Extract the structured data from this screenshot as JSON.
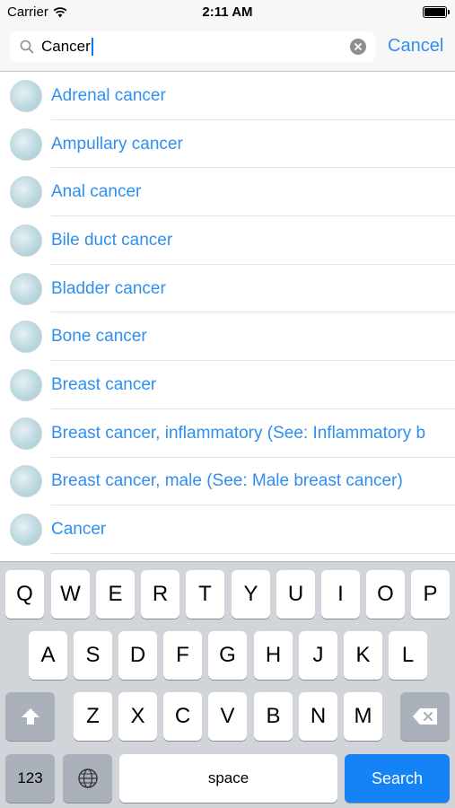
{
  "status_bar": {
    "carrier": "Carrier",
    "time": "2:11 AM"
  },
  "search": {
    "query": "Cancer",
    "cancel_label": "Cancel"
  },
  "results": [
    {
      "label": "Adrenal cancer"
    },
    {
      "label": "Ampullary cancer"
    },
    {
      "label": "Anal cancer"
    },
    {
      "label": "Bile duct cancer"
    },
    {
      "label": "Bladder cancer"
    },
    {
      "label": "Bone cancer"
    },
    {
      "label": "Breast cancer"
    },
    {
      "label": "Breast cancer, inflammatory (See: Inflammatory b"
    },
    {
      "label": "Breast cancer, male (See: Male breast cancer)"
    },
    {
      "label": "Cancer"
    }
  ],
  "keyboard": {
    "row1": [
      "Q",
      "W",
      "E",
      "R",
      "T",
      "Y",
      "U",
      "I",
      "O",
      "P"
    ],
    "row2": [
      "A",
      "S",
      "D",
      "F",
      "G",
      "H",
      "J",
      "K",
      "L"
    ],
    "row3": [
      "Z",
      "X",
      "C",
      "V",
      "B",
      "N",
      "M"
    ],
    "numbers_label": "123",
    "space_label": "space",
    "search_label": "Search",
    "icons": {
      "shift": "shift-arrow-icon",
      "delete": "backspace-icon",
      "globe": "globe-icon"
    }
  },
  "colors": {
    "link_blue": "#2f8ff0",
    "search_key_blue": "#1483f5",
    "keyboard_bg": "#d1d4d9"
  }
}
